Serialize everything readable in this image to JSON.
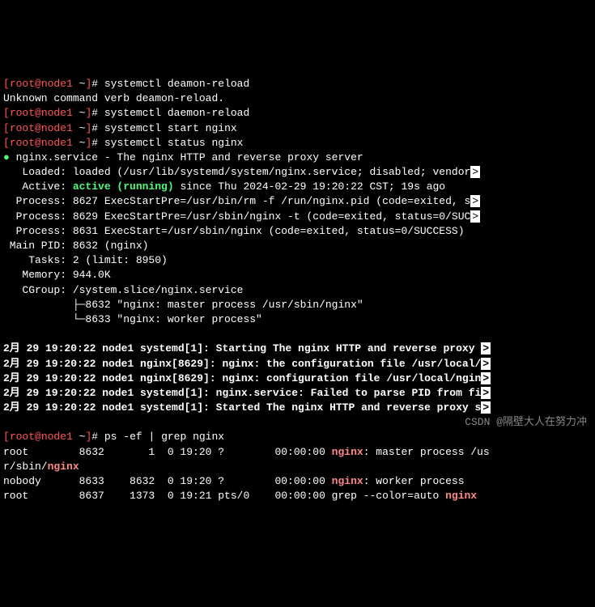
{
  "prompt": {
    "lbracket": "[",
    "user_host": "root@node1",
    "path": " ~",
    "rbracket": "]",
    "hash": "# "
  },
  "cmd1": "systemctl deamon-reload",
  "err1": "Unknown command verb deamon-reload.",
  "cmd2": "systemctl daemon-reload",
  "cmd3": "systemctl start nginx",
  "cmd4": "systemctl status nginx",
  "status": {
    "dot": "●",
    "header": " nginx.service - The nginx HTTP and reverse proxy server",
    "loaded": "   Loaded: loaded (/usr/lib/systemd/system/nginx.service; disabled; vendor",
    "loaded_ind": ">",
    "active_lbl": "   Active: ",
    "active_val": "active (running)",
    "active_since": " since Thu 2024-02-29 19:20:22 CST; 19s ago",
    "proc1": "  Process: 8627 ExecStartPre=/usr/bin/rm -f /run/nginx.pid (code=exited, s",
    "proc1_ind": ">",
    "proc2": "  Process: 8629 ExecStartPre=/usr/sbin/nginx -t (code=exited, status=0/SUC",
    "proc2_ind": ">",
    "proc3": "  Process: 8631 ExecStart=/usr/sbin/nginx (code=exited, status=0/SUCCESS)",
    "mainpid": " Main PID: 8632 (nginx)",
    "tasks": "    Tasks: 2 (limit: 8950)",
    "memory": "   Memory: 944.0K",
    "cgroup": "   CGroup: /system.slice/nginx.service",
    "proc_tree1": "           ├─8632 \"nginx: master process /usr/sbin/nginx\"",
    "proc_tree2": "           └─8633 \"nginx: worker process\""
  },
  "journal": {
    "l1_a": "2月 29 19:20:22 node1 systemd[1]: Starting The nginx HTTP and reverse proxy ",
    "l1_b": ">",
    "l2_a": "2月 29 19:20:22 node1 nginx[8629]: nginx: the configuration file /usr/local/",
    "l2_b": ">",
    "l3_a": "2月 29 19:20:22 node1 nginx[8629]: nginx: configuration file /usr/local/ngin",
    "l3_b": ">",
    "l4_a": "2月 29 19:20:22 node1 systemd[1]: nginx.service: Failed to parse PID from fi",
    "l4_b": ">",
    "l5_a": "2月 29 19:20:22 node1 systemd[1]: Started The nginx HTTP and reverse proxy s",
    "l5_b": ">"
  },
  "cmd5": "ps -ef | grep nginx",
  "ps": {
    "r1a": "root        8632       1  0 19:20 ?        00:00:00 ",
    "r1b": "nginx",
    "r1c": ": master process /us",
    "r1d": "r/sbin/",
    "r1e": "nginx",
    "r2a": "nobody      8633    8632  0 19:20 ?        00:00:00 ",
    "r2b": "nginx",
    "r2c": ": worker process",
    "r3a": "root        8637    1373  0 19:21 pts/0    00:00:00 grep --color=auto ",
    "r3b": "nginx"
  },
  "watermark": "CSDN @隔壁大人在努力冲"
}
